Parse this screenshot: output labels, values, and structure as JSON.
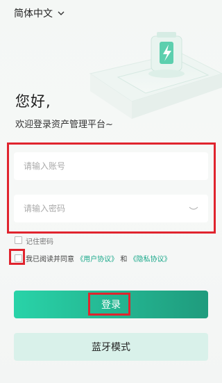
{
  "header": {
    "language_label": "简体中文"
  },
  "greeting": {
    "title": "您好,",
    "subtitle": "欢迎登录资产管理平台~"
  },
  "form": {
    "account_placeholder": "请输入账号",
    "password_placeholder": "请输入密码",
    "remember_label": "记住密码",
    "agree_prefix": "我已阅读并同意",
    "user_agreement": "《用户协议》",
    "and_text": "和",
    "privacy_agreement": "《隐私协议》"
  },
  "buttons": {
    "login_label": "登录",
    "bluetooth_label": "蓝牙模式"
  },
  "colors": {
    "accent": "#1fb48f",
    "highlight": "#e0242e",
    "secondary_bg": "#d9f1ea"
  }
}
